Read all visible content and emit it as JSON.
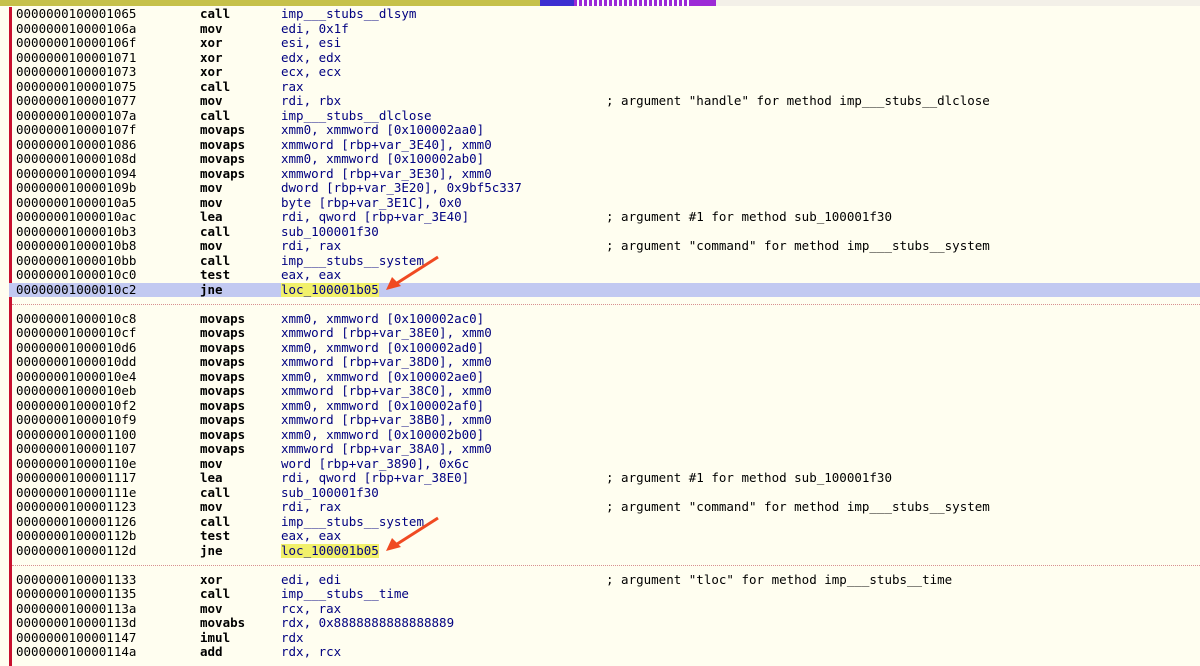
{
  "colors": {
    "background": "#fffef0",
    "selection": "#c2c9f1",
    "highlight": "#f1f06a",
    "arrow": "#f04a22",
    "navbar_olive": "#c6c14a",
    "navbar_blue": "#3c2fd1",
    "navbar_purple": "#9c2ad6"
  },
  "listing": {
    "blocks": [
      {
        "rows": [
          {
            "addr": "0000000100001065",
            "mnem": "call",
            "ops": "imp___stubs__dlsym",
            "comment": ""
          },
          {
            "addr": "000000010000106a",
            "mnem": "mov",
            "ops": "edi, 0x1f",
            "comment": ""
          },
          {
            "addr": "000000010000106f",
            "mnem": "xor",
            "ops": "esi, esi",
            "comment": ""
          },
          {
            "addr": "0000000100001071",
            "mnem": "xor",
            "ops": "edx, edx",
            "comment": ""
          },
          {
            "addr": "0000000100001073",
            "mnem": "xor",
            "ops": "ecx, ecx",
            "comment": ""
          },
          {
            "addr": "0000000100001075",
            "mnem": "call",
            "ops": "rax",
            "comment": ""
          },
          {
            "addr": "0000000100001077",
            "mnem": "mov",
            "ops": "rdi, rbx",
            "comment": "; argument \"handle\" for method imp___stubs__dlclose"
          },
          {
            "addr": "000000010000107a",
            "mnem": "call",
            "ops": "imp___stubs__dlclose",
            "comment": ""
          },
          {
            "addr": "000000010000107f",
            "mnem": "movaps",
            "ops": "xmm0, xmmword [0x100002aa0]",
            "comment": ""
          },
          {
            "addr": "0000000100001086",
            "mnem": "movaps",
            "ops": "xmmword [rbp+var_3E40], xmm0",
            "comment": ""
          },
          {
            "addr": "000000010000108d",
            "mnem": "movaps",
            "ops": "xmm0, xmmword [0x100002ab0]",
            "comment": ""
          },
          {
            "addr": "0000000100001094",
            "mnem": "movaps",
            "ops": "xmmword [rbp+var_3E30], xmm0",
            "comment": ""
          },
          {
            "addr": "000000010000109b",
            "mnem": "mov",
            "ops": "dword [rbp+var_3E20], 0x9bf5c337",
            "comment": ""
          },
          {
            "addr": "00000001000010a5",
            "mnem": "mov",
            "ops": "byte [rbp+var_3E1C], 0x0",
            "comment": ""
          },
          {
            "addr": "00000001000010ac",
            "mnem": "lea",
            "ops": "rdi, qword [rbp+var_3E40]",
            "comment": "; argument #1 for method sub_100001f30"
          },
          {
            "addr": "00000001000010b3",
            "mnem": "call",
            "ops": "sub_100001f30",
            "comment": ""
          },
          {
            "addr": "00000001000010b8",
            "mnem": "mov",
            "ops": "rdi, rax",
            "comment": "; argument \"command\" for method imp___stubs__system"
          },
          {
            "addr": "00000001000010bb",
            "mnem": "call",
            "ops": "imp___stubs__system",
            "comment": ""
          },
          {
            "addr": "00000001000010c0",
            "mnem": "test",
            "ops": "eax, eax",
            "comment": ""
          },
          {
            "addr": "00000001000010c2",
            "mnem": "jne",
            "ops": "loc_100001b05",
            "comment": "",
            "selected": true,
            "highlight": true,
            "arrow": true
          }
        ]
      },
      {
        "rows": [
          {
            "addr": "00000001000010c8",
            "mnem": "movaps",
            "ops": "xmm0, xmmword [0x100002ac0]",
            "comment": ""
          },
          {
            "addr": "00000001000010cf",
            "mnem": "movaps",
            "ops": "xmmword [rbp+var_38E0], xmm0",
            "comment": ""
          },
          {
            "addr": "00000001000010d6",
            "mnem": "movaps",
            "ops": "xmm0, xmmword [0x100002ad0]",
            "comment": ""
          },
          {
            "addr": "00000001000010dd",
            "mnem": "movaps",
            "ops": "xmmword [rbp+var_38D0], xmm0",
            "comment": ""
          },
          {
            "addr": "00000001000010e4",
            "mnem": "movaps",
            "ops": "xmm0, xmmword [0x100002ae0]",
            "comment": ""
          },
          {
            "addr": "00000001000010eb",
            "mnem": "movaps",
            "ops": "xmmword [rbp+var_38C0], xmm0",
            "comment": ""
          },
          {
            "addr": "00000001000010f2",
            "mnem": "movaps",
            "ops": "xmm0, xmmword [0x100002af0]",
            "comment": ""
          },
          {
            "addr": "00000001000010f9",
            "mnem": "movaps",
            "ops": "xmmword [rbp+var_38B0], xmm0",
            "comment": ""
          },
          {
            "addr": "0000000100001100",
            "mnem": "movaps",
            "ops": "xmm0, xmmword [0x100002b00]",
            "comment": ""
          },
          {
            "addr": "0000000100001107",
            "mnem": "movaps",
            "ops": "xmmword [rbp+var_38A0], xmm0",
            "comment": ""
          },
          {
            "addr": "000000010000110e",
            "mnem": "mov",
            "ops": "word [rbp+var_3890], 0x6c",
            "comment": ""
          },
          {
            "addr": "0000000100001117",
            "mnem": "lea",
            "ops": "rdi, qword [rbp+var_38E0]",
            "comment": "; argument #1 for method sub_100001f30"
          },
          {
            "addr": "000000010000111e",
            "mnem": "call",
            "ops": "sub_100001f30",
            "comment": ""
          },
          {
            "addr": "0000000100001123",
            "mnem": "mov",
            "ops": "rdi, rax",
            "comment": "; argument \"command\" for method imp___stubs__system"
          },
          {
            "addr": "0000000100001126",
            "mnem": "call",
            "ops": "imp___stubs__system",
            "comment": ""
          },
          {
            "addr": "000000010000112b",
            "mnem": "test",
            "ops": "eax, eax",
            "comment": ""
          },
          {
            "addr": "000000010000112d",
            "mnem": "jne",
            "ops": "loc_100001b05",
            "comment": "",
            "highlight": true,
            "arrow": true
          }
        ]
      },
      {
        "rows": [
          {
            "addr": "0000000100001133",
            "mnem": "xor",
            "ops": "edi, edi",
            "comment": "; argument \"tloc\" for method imp___stubs__time"
          },
          {
            "addr": "0000000100001135",
            "mnem": "call",
            "ops": "imp___stubs__time",
            "comment": ""
          },
          {
            "addr": "000000010000113a",
            "mnem": "mov",
            "ops": "rcx, rax",
            "comment": ""
          },
          {
            "addr": "000000010000113d",
            "mnem": "movabs",
            "ops": "rdx, 0x8888888888888889",
            "comment": ""
          },
          {
            "addr": "0000000100001147",
            "mnem": "imul",
            "ops": "rdx",
            "comment": ""
          },
          {
            "addr": "000000010000114a",
            "mnem": "add",
            "ops": "rdx, rcx",
            "comment": ""
          }
        ]
      }
    ]
  }
}
